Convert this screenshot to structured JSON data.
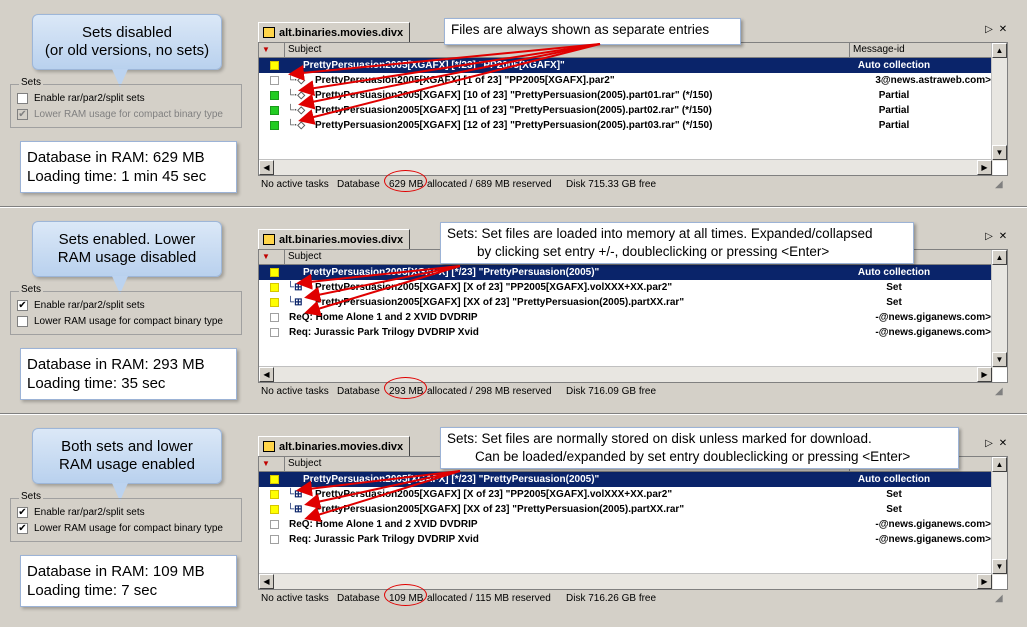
{
  "colors": {
    "arrow": "#e00000",
    "selected_row": "#0a246a",
    "green_marker": "#22cc22",
    "yellow_marker": "#ffff00"
  },
  "grid_header": {
    "subject": "Subject",
    "message_id": "Message-id"
  },
  "sets_group_title": "Sets",
  "checkbox_labels": {
    "enable_sets": "Enable rar/par2/split sets",
    "low_ram": "Lower RAM usage for compact binary type"
  },
  "panels": [
    {
      "bubble_lines": [
        "Sets disabled",
        "(or old versions, no sets)"
      ],
      "enable_sets_checked": false,
      "low_ram_checked": true,
      "low_ram_disabled": true,
      "stats_lines": [
        "Database in RAM: 629 MB",
        "Loading time: 1 min 45 sec"
      ],
      "tab": "alt.binaries.movies.divx",
      "callout_lines": [
        "Files are always shown as separate entries"
      ],
      "rows": [
        {
          "marker": "yellow",
          "subject": "PrettyPersuasion2005[XGAFX] [*/23] \"PP2005[XGAFX]\"",
          "right": "Auto collection",
          "kind": "selected"
        },
        {
          "marker": "none",
          "subject": "PrettyPersuasion2005[XGAFX] [1 of 23] \"PP2005[XGAFX].par2\"",
          "right": "3@news.astraweb.com>",
          "kind": "child"
        },
        {
          "marker": "green",
          "subject": "PrettyPersuasion2005[XGAFX] [10 of 23] \"PrettyPersuasion(2005).part01.rar\" (*/150)",
          "right": "Partial",
          "kind": "child"
        },
        {
          "marker": "green",
          "subject": "PrettyPersuasion2005[XGAFX] [11 of 23] \"PrettyPersuasion(2005).part02.rar\" (*/150)",
          "right": "Partial",
          "kind": "child"
        },
        {
          "marker": "green",
          "subject": "PrettyPersuasion2005[XGAFX] [12 of 23] \"PrettyPersuasion(2005).part03.rar\" (*/150)",
          "right": "Partial",
          "kind": "child"
        }
      ],
      "status": {
        "tasks": "No active tasks",
        "db_label": "Database",
        "db_value": "629 MB",
        "db_rest": "allocated / 689 MB reserved",
        "disk": "Disk 715.33 GB free"
      }
    },
    {
      "bubble_lines": [
        "Sets enabled. Lower",
        "RAM usage disabled"
      ],
      "enable_sets_checked": true,
      "low_ram_checked": false,
      "low_ram_disabled": false,
      "stats_lines": [
        "Database in RAM: 293 MB",
        "Loading time: 35 sec"
      ],
      "tab": "alt.binaries.movies.divx",
      "callout_lines": [
        "Sets: Set files are loaded into memory at all times. Expanded/collapsed",
        "by clicking set entry +/-, doubleclicking or pressing <Enter>"
      ],
      "rows": [
        {
          "marker": "yellow",
          "subject": "PrettyPersuasion2005[XGAFX] [*/23] \"PrettyPersuasion(2005)\"",
          "right": "Auto collection",
          "kind": "selected"
        },
        {
          "marker": "yellow",
          "subject": "PrettyPersuasion2005[XGAFX] [X of 23] \"PP2005[XGAFX].volXXX+XX.par2\"",
          "right": "Set",
          "kind": "set"
        },
        {
          "marker": "yellow",
          "subject": "PrettyPersuasion2005[XGAFX] [XX of 23] \"PrettyPersuasion(2005).partXX.rar\"",
          "right": "Set",
          "kind": "set"
        },
        {
          "marker": "none",
          "subject": "ReQ: Home Alone 1 and 2 XVID DVDRIP",
          "right": "-@news.giganews.com>",
          "kind": "plain"
        },
        {
          "marker": "none",
          "subject": "Req: Jurassic Park Trilogy DVDRIP Xvid",
          "right": "-@news.giganews.com>",
          "kind": "plain"
        }
      ],
      "status": {
        "tasks": "No active tasks",
        "db_label": "Database",
        "db_value": "293 MB",
        "db_rest": "allocated / 298 MB reserved",
        "disk": "Disk 716.09 GB free"
      }
    },
    {
      "bubble_lines": [
        "Both sets and lower",
        "RAM usage enabled"
      ],
      "enable_sets_checked": true,
      "low_ram_checked": true,
      "low_ram_disabled": false,
      "stats_lines": [
        "Database in RAM: 109 MB",
        "Loading time: 7 sec"
      ],
      "tab": "alt.binaries.movies.divx",
      "callout_lines": [
        "Sets: Set files are normally stored on disk unless marked for download.",
        "Can be loaded/expanded by set entry doubleclicking or pressing <Enter>"
      ],
      "rows": [
        {
          "marker": "yellow",
          "subject": "PrettyPersuasion2005[XGAFX] [*/23] \"PrettyPersuasion(2005)\"",
          "right": "Auto collection",
          "kind": "selected"
        },
        {
          "marker": "yellow",
          "subject": "PrettyPersuasion2005[XGAFX] [X of 23] \"PP2005[XGAFX].volXXX+XX.par2\"",
          "right": "Set",
          "kind": "set"
        },
        {
          "marker": "yellow",
          "subject": "PrettyPersuasion2005[XGAFX] [XX of 23] \"PrettyPersuasion(2005).partXX.rar\"",
          "right": "Set",
          "kind": "set"
        },
        {
          "marker": "none",
          "subject": "ReQ: Home Alone 1 and 2 XVID DVDRIP",
          "right": "-@news.giganews.com>",
          "kind": "plain"
        },
        {
          "marker": "none",
          "subject": "Req: Jurassic Park Trilogy DVDRIP Xvid",
          "right": "-@news.giganews.com>",
          "kind": "plain"
        }
      ],
      "status": {
        "tasks": "No active tasks",
        "db_label": "Database",
        "db_value": "109 MB",
        "db_rest": "allocated / 115 MB reserved",
        "disk": "Disk 716.26 GB free"
      }
    }
  ]
}
